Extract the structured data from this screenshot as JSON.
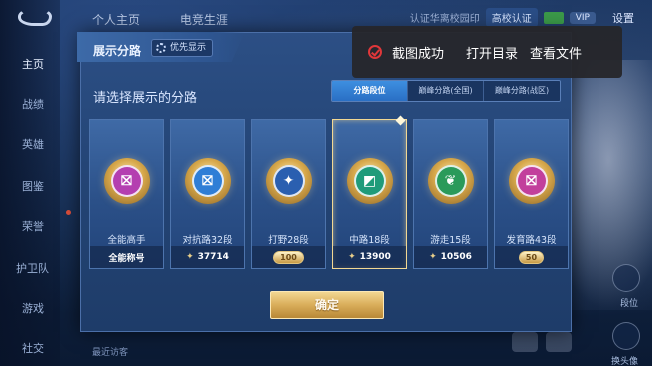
{
  "background": {
    "nav_items": [
      "主页",
      "战绩",
      "英雄",
      "图鉴",
      "荣誉",
      "护卫队",
      "游戏",
      "社交"
    ],
    "top_tabs": [
      "个人主页",
      "电竞生涯"
    ],
    "top_right": {
      "auth_partial": "认证华离校园印",
      "auth_badge": "高校认证",
      "vip": "VIP",
      "settings": "设置"
    },
    "right_labels": [
      "段位",
      "换头像"
    ],
    "bottom_text": "最近访客"
  },
  "modal": {
    "title": "展示分路",
    "priority_label": "优先显示",
    "subtitle": "请选择展示的分路",
    "segments": [
      "分路段位",
      "巅峰分路(全国)",
      "巅峰分路(战区)"
    ],
    "active_segment": 0,
    "cards": [
      {
        "name": "全能高手",
        "foot": "全能称号",
        "foot_type": "text",
        "color": "#b43fb0",
        "glyph": "⛝",
        "selected": false
      },
      {
        "name": "对抗路32段",
        "foot": "37714",
        "foot_type": "score",
        "color": "#2f7ed6",
        "glyph": "⛝",
        "selected": false
      },
      {
        "name": "打野28段",
        "foot": "100",
        "foot_type": "plaque",
        "color": "#2a5fb0",
        "glyph": "✦",
        "selected": false
      },
      {
        "name": "中路18段",
        "foot": "13900",
        "foot_type": "score",
        "color": "#1f9b7a",
        "glyph": "◩",
        "selected": true
      },
      {
        "name": "游走15段",
        "foot": "10506",
        "foot_type": "score",
        "color": "#2a9a5a",
        "glyph": "❦",
        "selected": false
      },
      {
        "name": "发育路43段",
        "foot": "50",
        "foot_type": "plaque",
        "color": "#c23f9c",
        "glyph": "⛝",
        "selected": false
      }
    ],
    "confirm_label": "确定"
  },
  "toast": {
    "message": "截图成功",
    "open_dir": "打开目录",
    "view_file": "查看文件"
  }
}
